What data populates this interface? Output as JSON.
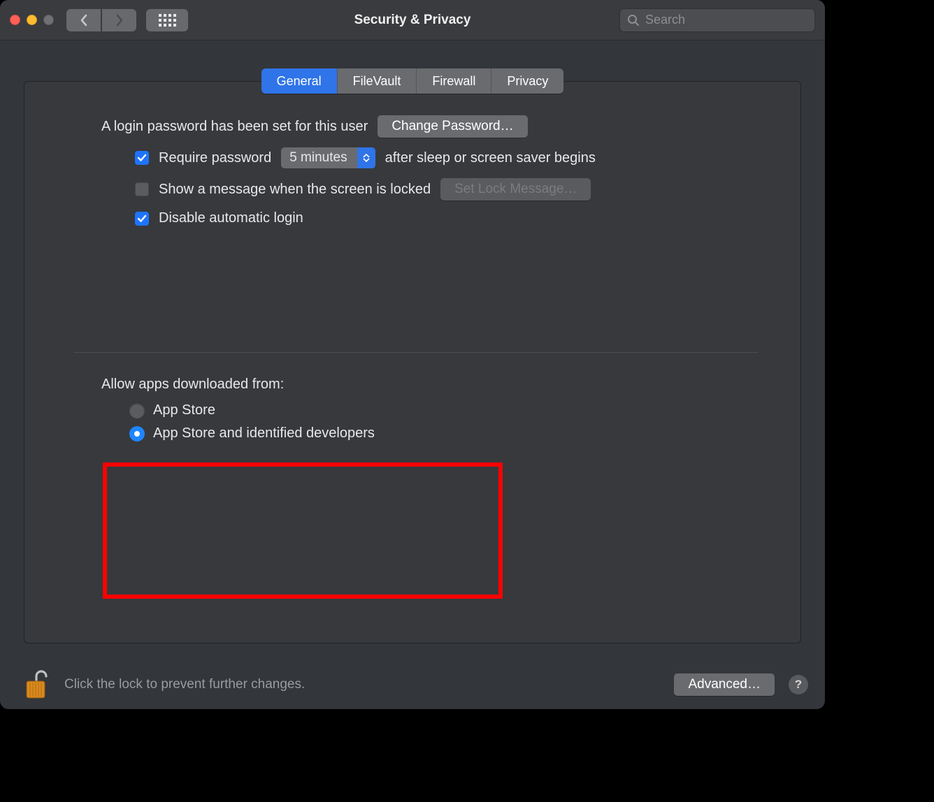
{
  "titlebar": {
    "title": "Security & Privacy",
    "search_placeholder": "Search"
  },
  "tabs": {
    "general": "General",
    "filevault": "FileVault",
    "firewall": "Firewall",
    "privacy": "Privacy",
    "active": "general"
  },
  "general": {
    "login_password_text": "A login password has been set for this user",
    "change_password_label": "Change Password…",
    "require_password_label": "Require password",
    "require_password_delay": "5 minutes",
    "after_sleep_text": "after sleep or screen saver begins",
    "show_message_label": "Show a message when the screen is locked",
    "set_lock_message_label": "Set Lock Message…",
    "disable_auto_login_label": "Disable automatic login",
    "require_password_checked": true,
    "show_message_checked": false,
    "disable_auto_login_checked": true
  },
  "allow": {
    "heading": "Allow apps downloaded from:",
    "option_app_store": "App Store",
    "option_identified": "App Store and identified developers",
    "selected": "identified"
  },
  "footer": {
    "lock_text": "Click the lock to prevent further changes.",
    "advanced_label": "Advanced…",
    "help_label": "?"
  }
}
